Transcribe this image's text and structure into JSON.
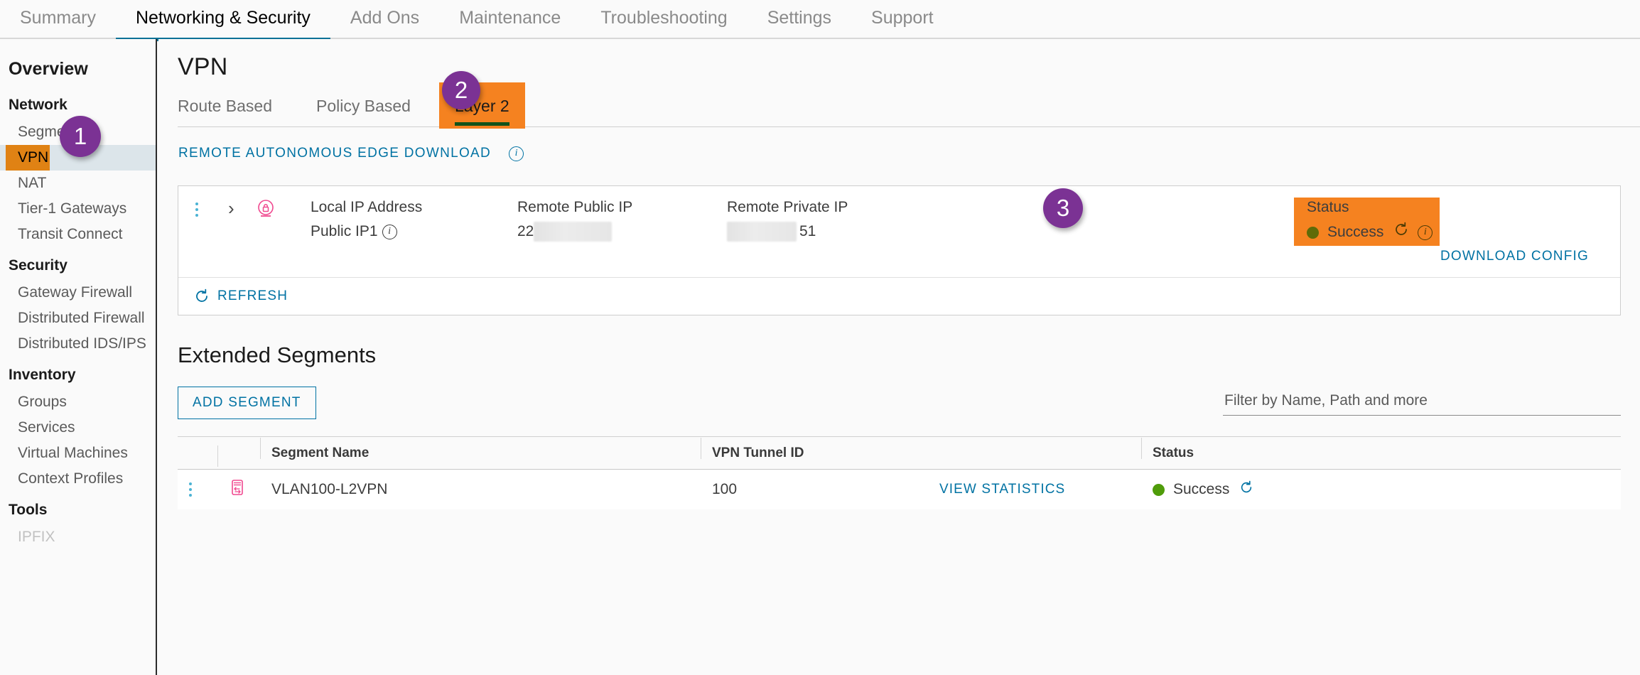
{
  "topnav": {
    "tabs": [
      {
        "label": "Summary",
        "active": false
      },
      {
        "label": "Networking & Security",
        "active": true
      },
      {
        "label": "Add Ons",
        "active": false
      },
      {
        "label": "Maintenance",
        "active": false
      },
      {
        "label": "Troubleshooting",
        "active": false
      },
      {
        "label": "Settings",
        "active": false
      },
      {
        "label": "Support",
        "active": false
      }
    ]
  },
  "sidebar": {
    "overview": "Overview",
    "groups": [
      {
        "title": "Network",
        "items": [
          "Segments",
          "VPN",
          "NAT",
          "Tier-1 Gateways",
          "Transit Connect"
        ]
      },
      {
        "title": "Security",
        "items": [
          "Gateway Firewall",
          "Distributed Firewall",
          "Distributed IDS/IPS"
        ]
      },
      {
        "title": "Inventory",
        "items": [
          "Groups",
          "Services",
          "Virtual Machines",
          "Context Profiles"
        ]
      },
      {
        "title": "Tools",
        "items": [
          "IPFIX"
        ]
      }
    ],
    "selected_item": "VPN"
  },
  "main": {
    "page_title": "VPN",
    "tabs": [
      {
        "label": "Route Based",
        "active": false
      },
      {
        "label": "Policy Based",
        "active": false
      },
      {
        "label": "Layer 2",
        "active": true
      }
    ],
    "remote_download_link": "REMOTE AUTONOMOUS EDGE DOWNLOAD",
    "info_icon": "info-icon"
  },
  "vpn_card": {
    "columns": [
      {
        "header": "Local IP Address",
        "value": "Public IP1",
        "has_info": true
      },
      {
        "header": "Remote Public IP",
        "value": "22",
        "redacted": true
      },
      {
        "header": "Remote Private IP",
        "value": "51",
        "redacted": true
      }
    ],
    "status": {
      "header": "Status",
      "value": "Success",
      "dot_color": "#4f9c0a",
      "refresh_icon": "refresh-icon",
      "info_icon": "info-icon"
    },
    "download_config": "DOWNLOAD CONFIG",
    "refresh": "REFRESH",
    "lock_icon": "lock-icon",
    "kebab_icon": "kebab-menu-icon",
    "expand_icon": "chevron-right-icon"
  },
  "extended_segments": {
    "title": "Extended Segments",
    "add_button": "ADD SEGMENT",
    "filter_placeholder": "Filter by Name, Path and more",
    "filter_value": "",
    "columns": [
      "",
      "",
      "Segment Name",
      "VPN Tunnel ID",
      "",
      "Status"
    ],
    "rows": [
      {
        "segment_name": "VLAN100-L2VPN",
        "tunnel_id": "100",
        "stats_link": "VIEW STATISTICS",
        "status": "Success",
        "status_dot": "#4f9c0a",
        "icon": "segment-icon",
        "kebab": "kebab-menu-icon"
      }
    ]
  },
  "callouts": [
    {
      "number": "1",
      "target": "sidebar-vpn"
    },
    {
      "number": "2",
      "target": "tab-layer-2"
    },
    {
      "number": "3",
      "target": "status-success"
    }
  ],
  "colors": {
    "accent_blue": "#0072a3",
    "highlight_orange": "#f58220",
    "sidebar_highlight_orange": "#e08214",
    "callout_purple": "#7b3294",
    "success_green": "#4f9c0a",
    "active_tab_underline": "#13531a",
    "topnav_active": "#0c7196",
    "lock_pink": "#f0488f"
  }
}
